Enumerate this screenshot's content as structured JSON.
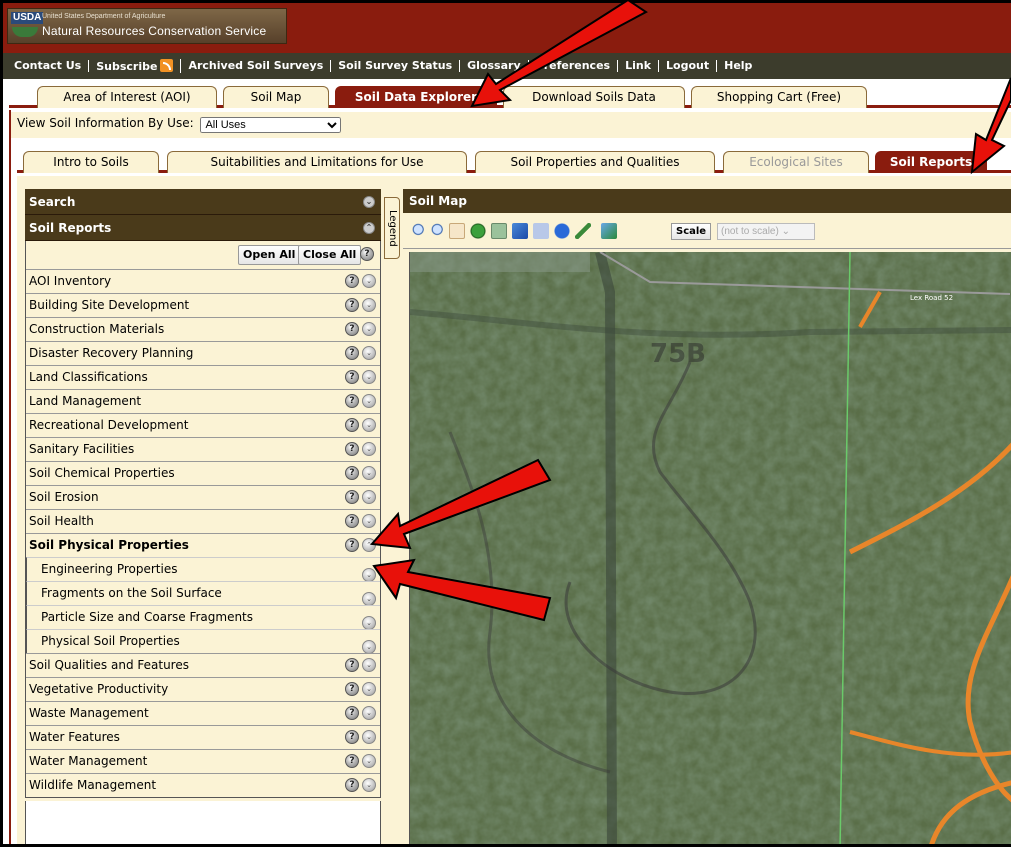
{
  "branding": {
    "logo_text": "USDA",
    "department": "United States Department of Agriculture",
    "agency": "Natural Resources Conservation Service"
  },
  "top_nav": [
    {
      "label": "Contact Us"
    },
    {
      "label": "Subscribe"
    },
    {
      "label": "Archived Soil Surveys"
    },
    {
      "label": "Soil Survey Status"
    },
    {
      "label": "Glossary"
    },
    {
      "label": "Preferences"
    },
    {
      "label": "Link"
    },
    {
      "label": "Logout"
    },
    {
      "label": "Help"
    }
  ],
  "main_tabs": [
    {
      "label": "Area of Interest (AOI)",
      "active": false
    },
    {
      "label": "Soil Map",
      "active": false
    },
    {
      "label": "Soil Data Explorer",
      "active": true
    },
    {
      "label": "Download Soils Data",
      "active": false
    },
    {
      "label": "Shopping Cart (Free)",
      "active": false
    }
  ],
  "view_by": {
    "label": "View Soil Information By Use:",
    "selected": "All Uses"
  },
  "sub_tabs": [
    {
      "label": "Intro to Soils",
      "state": "normal"
    },
    {
      "label": "Suitabilities and Limitations for Use",
      "state": "normal"
    },
    {
      "label": "Soil Properties and Qualities",
      "state": "normal"
    },
    {
      "label": "Ecological Sites",
      "state": "disabled"
    },
    {
      "label": "Soil Reports",
      "state": "active"
    }
  ],
  "left_panel": {
    "search_title": "Search",
    "reports_title": "Soil Reports",
    "open_all": "Open All",
    "close_all": "Close All",
    "help_glyph": "?",
    "expand_glyph": "⌄",
    "collapse_glyph": "⌃",
    "categories": [
      "AOI Inventory",
      "Building Site Development",
      "Construction Materials",
      "Disaster Recovery Planning",
      "Land Classifications",
      "Land Management",
      "Recreational Development",
      "Sanitary Facilities",
      "Soil Chemical Properties",
      "Soil Erosion",
      "Soil Health"
    ],
    "expanded_category": "Soil Physical Properties",
    "expanded_items": [
      "Engineering Properties",
      "Fragments on the Soil Surface",
      "Particle Size and Coarse Fragments",
      "Physical Soil Properties"
    ],
    "categories_after": [
      "Soil Qualities and Features",
      "Vegetative Productivity",
      "Waste Management",
      "Water Features",
      "Water Management",
      "Wildlife Management"
    ]
  },
  "legend_tab": "Legend",
  "map_panel": {
    "title": "Soil Map",
    "scale_label": "Scale",
    "scale_value": "(not to scale)",
    "road_label": "Lex Road 52",
    "map_unit_label": "75B"
  },
  "colors": {
    "brand_red": "#8a1c0e",
    "panel_brown": "#4a3a1a",
    "tab_cream": "#fbf3d5",
    "annotation_arrow": "#e8110a",
    "soil_line": "#e8862a"
  }
}
